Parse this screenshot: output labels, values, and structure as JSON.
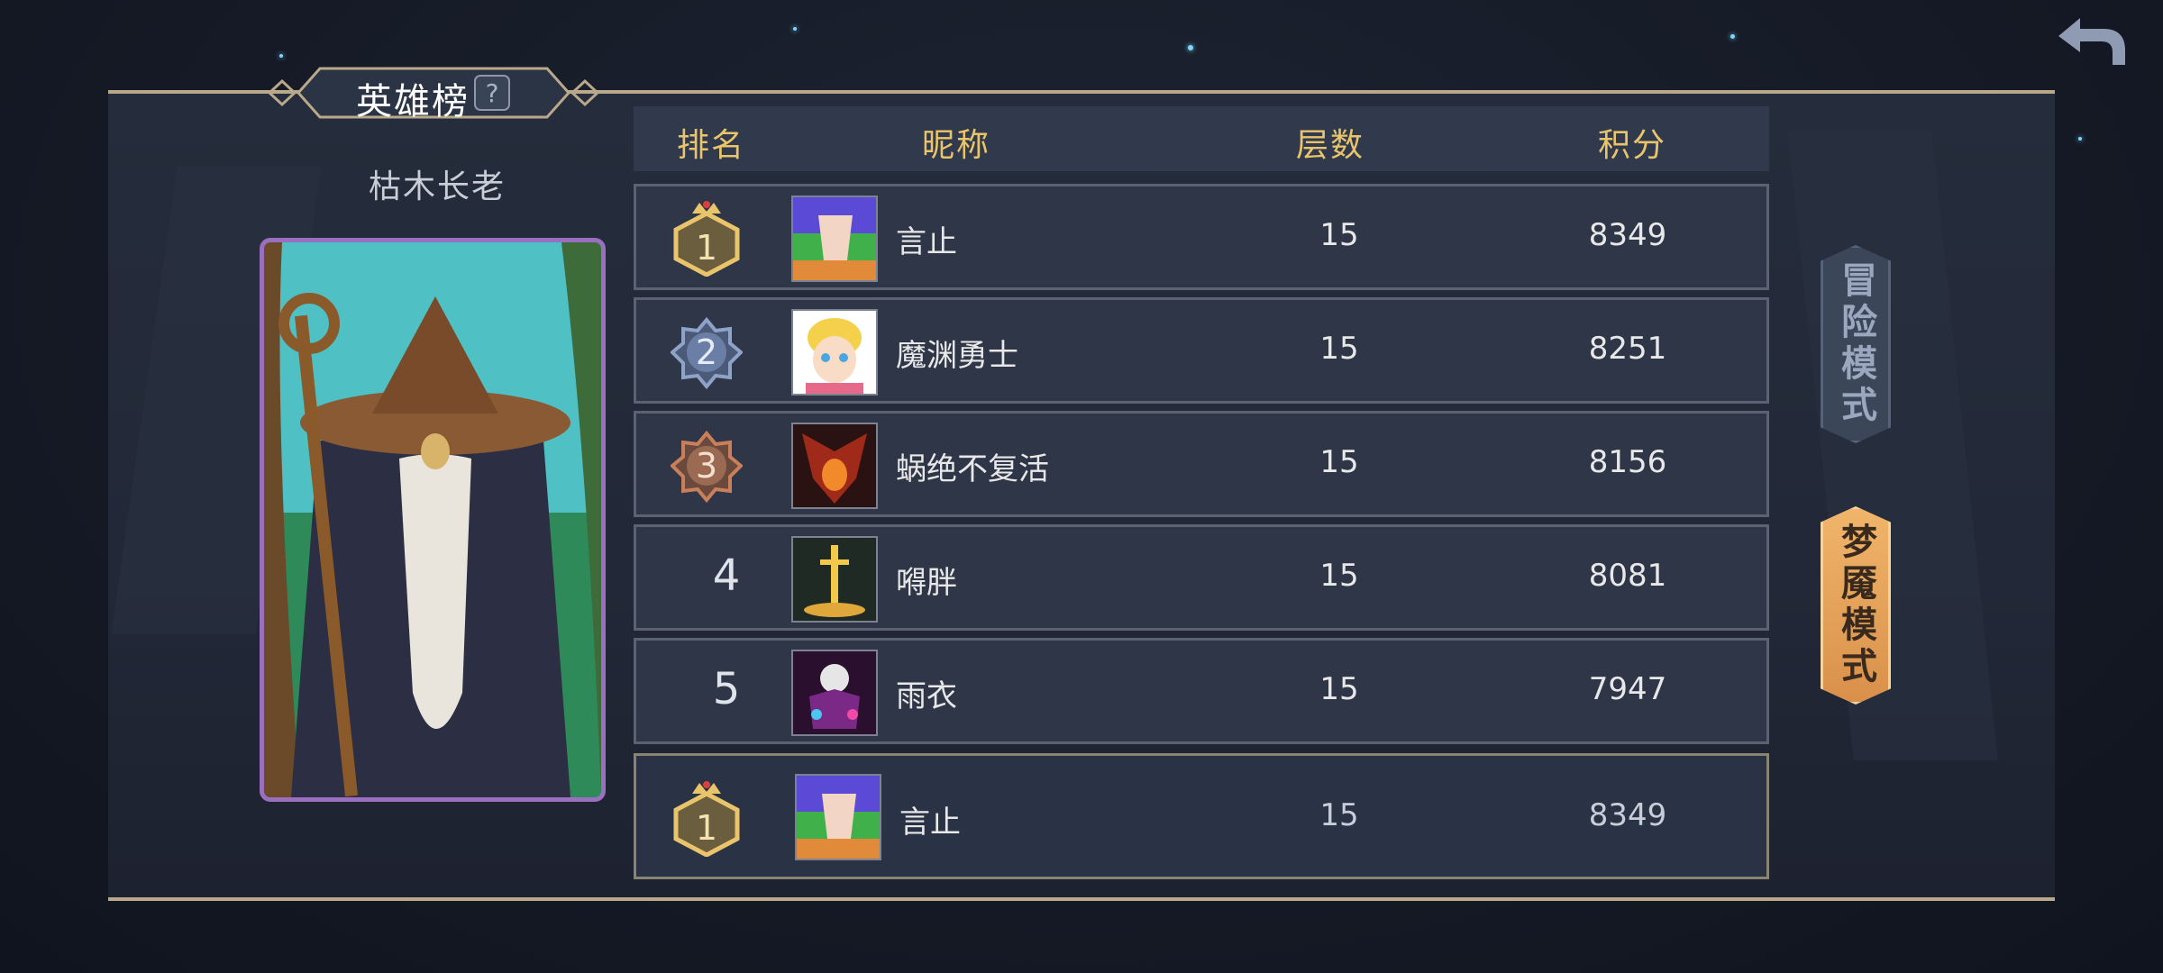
{
  "header": {
    "title": "英雄榜",
    "help_icon": "help-icon",
    "back_icon": "back-arrow-icon"
  },
  "hero": {
    "name": "枯木长老"
  },
  "table": {
    "columns": [
      "排名",
      "昵称",
      "层数",
      "积分"
    ],
    "rows": [
      {
        "rank": "1",
        "nickname": "言止",
        "floors": "15",
        "score": "8349",
        "badge": "gold"
      },
      {
        "rank": "2",
        "nickname": "魔渊勇士",
        "floors": "15",
        "score": "8251",
        "badge": "silver"
      },
      {
        "rank": "3",
        "nickname": "蜗绝不复活",
        "floors": "15",
        "score": "8156",
        "badge": "bronze"
      },
      {
        "rank": "4",
        "nickname": "嘚胖",
        "floors": "15",
        "score": "8081",
        "badge": ""
      },
      {
        "rank": "5",
        "nickname": "雨衣",
        "floors": "15",
        "score": "7947",
        "badge": ""
      }
    ],
    "self_row": {
      "rank": "1",
      "nickname": "言止",
      "floors": "15",
      "score": "8349",
      "badge": "gold"
    }
  },
  "modes": {
    "adventure": "冒险模式",
    "nightmare": "梦魇模式",
    "active": "nightmare"
  },
  "colors": {
    "gold": "#e9c46a",
    "silver": "#8fa3c8",
    "bronze": "#c9805a",
    "active_mode": "#e8a458"
  }
}
